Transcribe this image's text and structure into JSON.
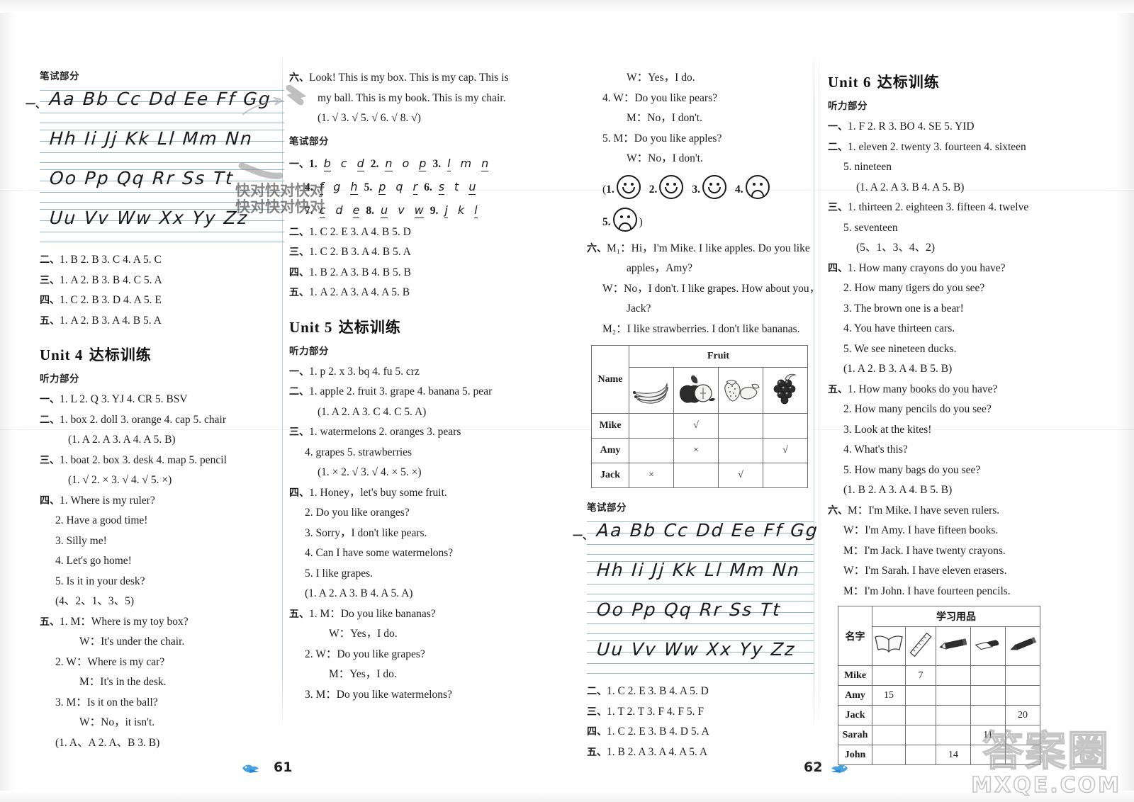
{
  "watermark": {
    "overlay_text": "快对快对快对",
    "brand_cn": "答案圈",
    "brand_en": "MXQE.COM"
  },
  "footer": {
    "page_left": "61",
    "page_right": "62",
    "bird_icon": "bird-icon"
  },
  "columns": {
    "col1": {
      "written_header": "笔试部分",
      "alphabet_rows": [
        "Aa Bb Cc Dd Ee Ff Gg",
        "Hh Ii Jj Kk Ll Mm Nn",
        "Oo Pp Qq Rr Ss Tt",
        "Uu Vv Ww Xx Yy Zz"
      ],
      "alphabet_lead": "一、",
      "answers": [
        {
          "label": "二、",
          "text": "1. B   2. B   3. C   4. A   5. C"
        },
        {
          "label": "三、",
          "text": "1. A   2. B   3. B   4. C   5. A"
        },
        {
          "label": "四、",
          "text": "1. C   2. B   3. D   4. A   5. E"
        },
        {
          "label": "五、",
          "text": "1. A   2. B   3. A   4. B   5. A"
        }
      ],
      "unit": {
        "title_en": "Unit 4",
        "title_cn": "达标训练",
        "listening_header": "听力部分",
        "items": [
          {
            "label": "一、",
            "lines": [
              "1. L   2. Q   3. YJ   4. CR   5. BSV"
            ]
          },
          {
            "label": "二、",
            "lines": [
              "1. box   2. doll   3. orange   4. cap   5. chair",
              "(1. A   2. A   3. A   4. A   5. B)"
            ]
          },
          {
            "label": "三、",
            "lines": [
              "1. boat   2. box   3. desk   4. map   5. pencil",
              "(1. √   2. ×   3. √   4. √   5. ×)"
            ]
          },
          {
            "label": "四、",
            "lines": [
              "1. Where is my ruler?",
              "2. Have a good time!",
              "3. Silly me!",
              "4. Let's go home!",
              "5. Is it in your desk?",
              "(4、2、1、3、5)"
            ]
          },
          {
            "label": "五、",
            "lines": [
              "1. M：Where is my toy box?",
              "W：It's under the chair.",
              "2. W：Where is my car?",
              "M：It's in the desk.",
              "3. M：Is it on the ball?",
              "W：No，it isn't.",
              "(1. A、A   2. A、B   3. B)"
            ]
          }
        ]
      }
    },
    "col2": {
      "item_six": {
        "label": "六、",
        "lines": [
          "Look! This is my box. This is my cap. This is",
          "my ball. This is my book. This is my chair.",
          "(1. √   3. √   5. √   6. √   8. √)"
        ]
      },
      "written_header": "笔试部分",
      "letters_label": "一、",
      "letter_rows": [
        [
          {
            "n": "1.",
            "a": "b",
            "b": "c",
            "c": "d"
          },
          {
            "n": "2.",
            "a": "n",
            "b": "o",
            "c": "p"
          },
          {
            "n": "3.",
            "a": "l",
            "b": "m",
            "c": "n"
          }
        ],
        [
          {
            "n": "4.",
            "a": "f",
            "b": "g",
            "c": "h"
          },
          {
            "n": "5.",
            "a": "p",
            "b": "q",
            "c": "r"
          },
          {
            "n": "6.",
            "a": "s",
            "b": "t",
            "c": "u"
          }
        ],
        [
          {
            "n": "7.",
            "a": "c",
            "b": "d",
            "c": "e"
          },
          {
            "n": "8.",
            "a": "u",
            "b": "v",
            "c": "w"
          },
          {
            "n": "9.",
            "a": "j",
            "b": "k",
            "c": "l"
          }
        ]
      ],
      "answers": [
        {
          "label": "二、",
          "text": "1. C   2. E   3. A   4. B   5. D"
        },
        {
          "label": "三、",
          "text": "1. C   2. B   3. A   4. B   5. A"
        },
        {
          "label": "四、",
          "text": "1. B   2. A   3. B   4. B   5. B"
        },
        {
          "label": "五、",
          "text": "1. A   2. A   3. A   4. A   5. B"
        }
      ],
      "unit": {
        "title_en": "Unit 5",
        "title_cn": "达标训练",
        "listening_header": "听力部分",
        "items": [
          {
            "label": "一、",
            "lines": [
              "1. p   2. x   3. bq   4. fu   5. crz"
            ]
          },
          {
            "label": "二、",
            "lines": [
              "1. apple   2. fruit   3. grape   4. banana   5. pear",
              "(1. A   2. A   3. C   4. C   5. A)"
            ]
          },
          {
            "label": "三、",
            "lines": [
              "1. watermelons   2. oranges   3. pears",
              "4. grapes   5. strawberries",
              "(1. ×   2. √   3. √   4. ×   5. ×)"
            ]
          },
          {
            "label": "四、",
            "lines": [
              "1. Honey，let's buy some fruit.",
              "2. Do you like oranges?",
              "3. Sorry，I don't like pears.",
              "4. Can I have some watermelons?",
              "5. I like grapes.",
              "(1. A   2. A   3. B   4. A   5. A)"
            ]
          },
          {
            "label": "五、",
            "lines": [
              "1. M：Do you like bananas?",
              "W：Yes，I do.",
              "2. W：Do you like grapes?",
              "M：Yes，I do.",
              "3. M：Do you like watermelons?"
            ]
          }
        ]
      }
    },
    "col3": {
      "continued": [
        "W：Yes，I do.",
        "4. W：Do you like pears?",
        "M：No，I don't.",
        "5. M：Do you like apples?",
        "W：No，I don't."
      ],
      "faces_answer": [
        {
          "n": "1.",
          "face": "happy"
        },
        {
          "n": "2.",
          "face": "happy"
        },
        {
          "n": "3.",
          "face": "happy"
        },
        {
          "n": "4.",
          "face": "sad"
        },
        {
          "n": "5.",
          "face": "sad"
        }
      ],
      "item_six": {
        "label": "六、",
        "lines": [
          "M₁：Hi，I'm Mike. I like apples. Do you like",
          "apples，Amy?",
          "W：No，I don't. I like grapes. How about you，",
          "Jack?",
          "M₂：I like strawberries. I don't like bananas."
        ]
      },
      "fruit_table": {
        "top_header": "Fruit",
        "name_header": "Name",
        "fruit_icons": [
          "banana-icon",
          "apple-icon",
          "strawberry-icon",
          "grape-icon"
        ],
        "rows": [
          {
            "name": "Mike",
            "cells": [
              "",
              "√",
              "",
              ""
            ]
          },
          {
            "name": "Amy",
            "cells": [
              "",
              "×",
              "",
              "√"
            ]
          },
          {
            "name": "Jack",
            "cells": [
              "×",
              "",
              "√",
              ""
            ]
          }
        ]
      },
      "written_header": "笔试部分",
      "alphabet_lead": "一、",
      "alphabet_rows": [
        "Aa Bb Cc Dd Ee Ff Gg",
        "Hh Ii Jj Kk Ll Mm Nn",
        "Oo Pp Qq Rr Ss Tt",
        "Uu Vv Ww Xx Yy Zz"
      ],
      "answers": [
        {
          "label": "二、",
          "text": "1. C   2. E   3. B   4. A   5. D"
        },
        {
          "label": "三、",
          "text": "1. T   2. T   3. F   4. F   5. F"
        },
        {
          "label": "四、",
          "text": "1. C   2. E   3. B   4. D   5. A"
        },
        {
          "label": "五、",
          "text": "1. B   2. A   3. A   4. A   5. A"
        }
      ]
    },
    "col4": {
      "unit": {
        "title_en": "Unit 6",
        "title_cn": "达标训练",
        "listening_header": "听力部分",
        "items": [
          {
            "label": "一、",
            "lines": [
              "1. F   2. R   3. BO   4. SE   5. YID"
            ]
          },
          {
            "label": "二、",
            "lines": [
              "1. eleven   2. twenty   3. fourteen   4. sixteen",
              "5. nineteen",
              "(1. A   2. A   3. B   4. A   5. B)"
            ]
          },
          {
            "label": "三、",
            "lines": [
              "1. thirteen   2. eighteen   3. fifteen   4. twelve",
              "5. seventeen",
              "(5、1、3、4、2)"
            ]
          },
          {
            "label": "四、",
            "lines": [
              "1. How many crayons do you have?",
              "2. How many tigers do you see?",
              "3. The brown one is a bear!",
              "4. You have thirteen cars.",
              "5. We see nineteen ducks.",
              "(1. A   2. B   3. A   4. B   5. B)"
            ]
          },
          {
            "label": "五、",
            "lines": [
              "1. How many books do you have?",
              "2. How many pencils do you see?",
              "3. Look at the kites!",
              "4. What's this?",
              "5. How many bags do you see?",
              "(1. B   2. A   3. A   4. B   5. B)"
            ]
          },
          {
            "label": "六、",
            "lines": [
              "M：I'm Mike. I have seven rulers.",
              "W：I'm Amy. I have fifteen books.",
              "M：I'm Jack. I have twenty crayons.",
              "W：I'm Sarah. I have eleven erasers.",
              "M：I'm John. I have fourteen pencils."
            ]
          }
        ]
      },
      "supplies_table": {
        "top_header": "学习用品",
        "name_header": "名字",
        "item_icons": [
          "book-icon",
          "ruler-icon",
          "pencil-icon",
          "eraser-icon",
          "crayon-icon"
        ],
        "rows": [
          {
            "name": "Mike",
            "cells": [
              "",
              "7",
              "",
              "",
              ""
            ]
          },
          {
            "name": "Amy",
            "cells": [
              "15",
              "",
              "",
              "",
              ""
            ]
          },
          {
            "name": "Jack",
            "cells": [
              "",
              "",
              "",
              "",
              "20"
            ]
          },
          {
            "name": "Sarah",
            "cells": [
              "",
              "",
              "",
              "11",
              ""
            ]
          },
          {
            "name": "John",
            "cells": [
              "",
              "",
              "14",
              "",
              ""
            ]
          }
        ]
      }
    }
  }
}
